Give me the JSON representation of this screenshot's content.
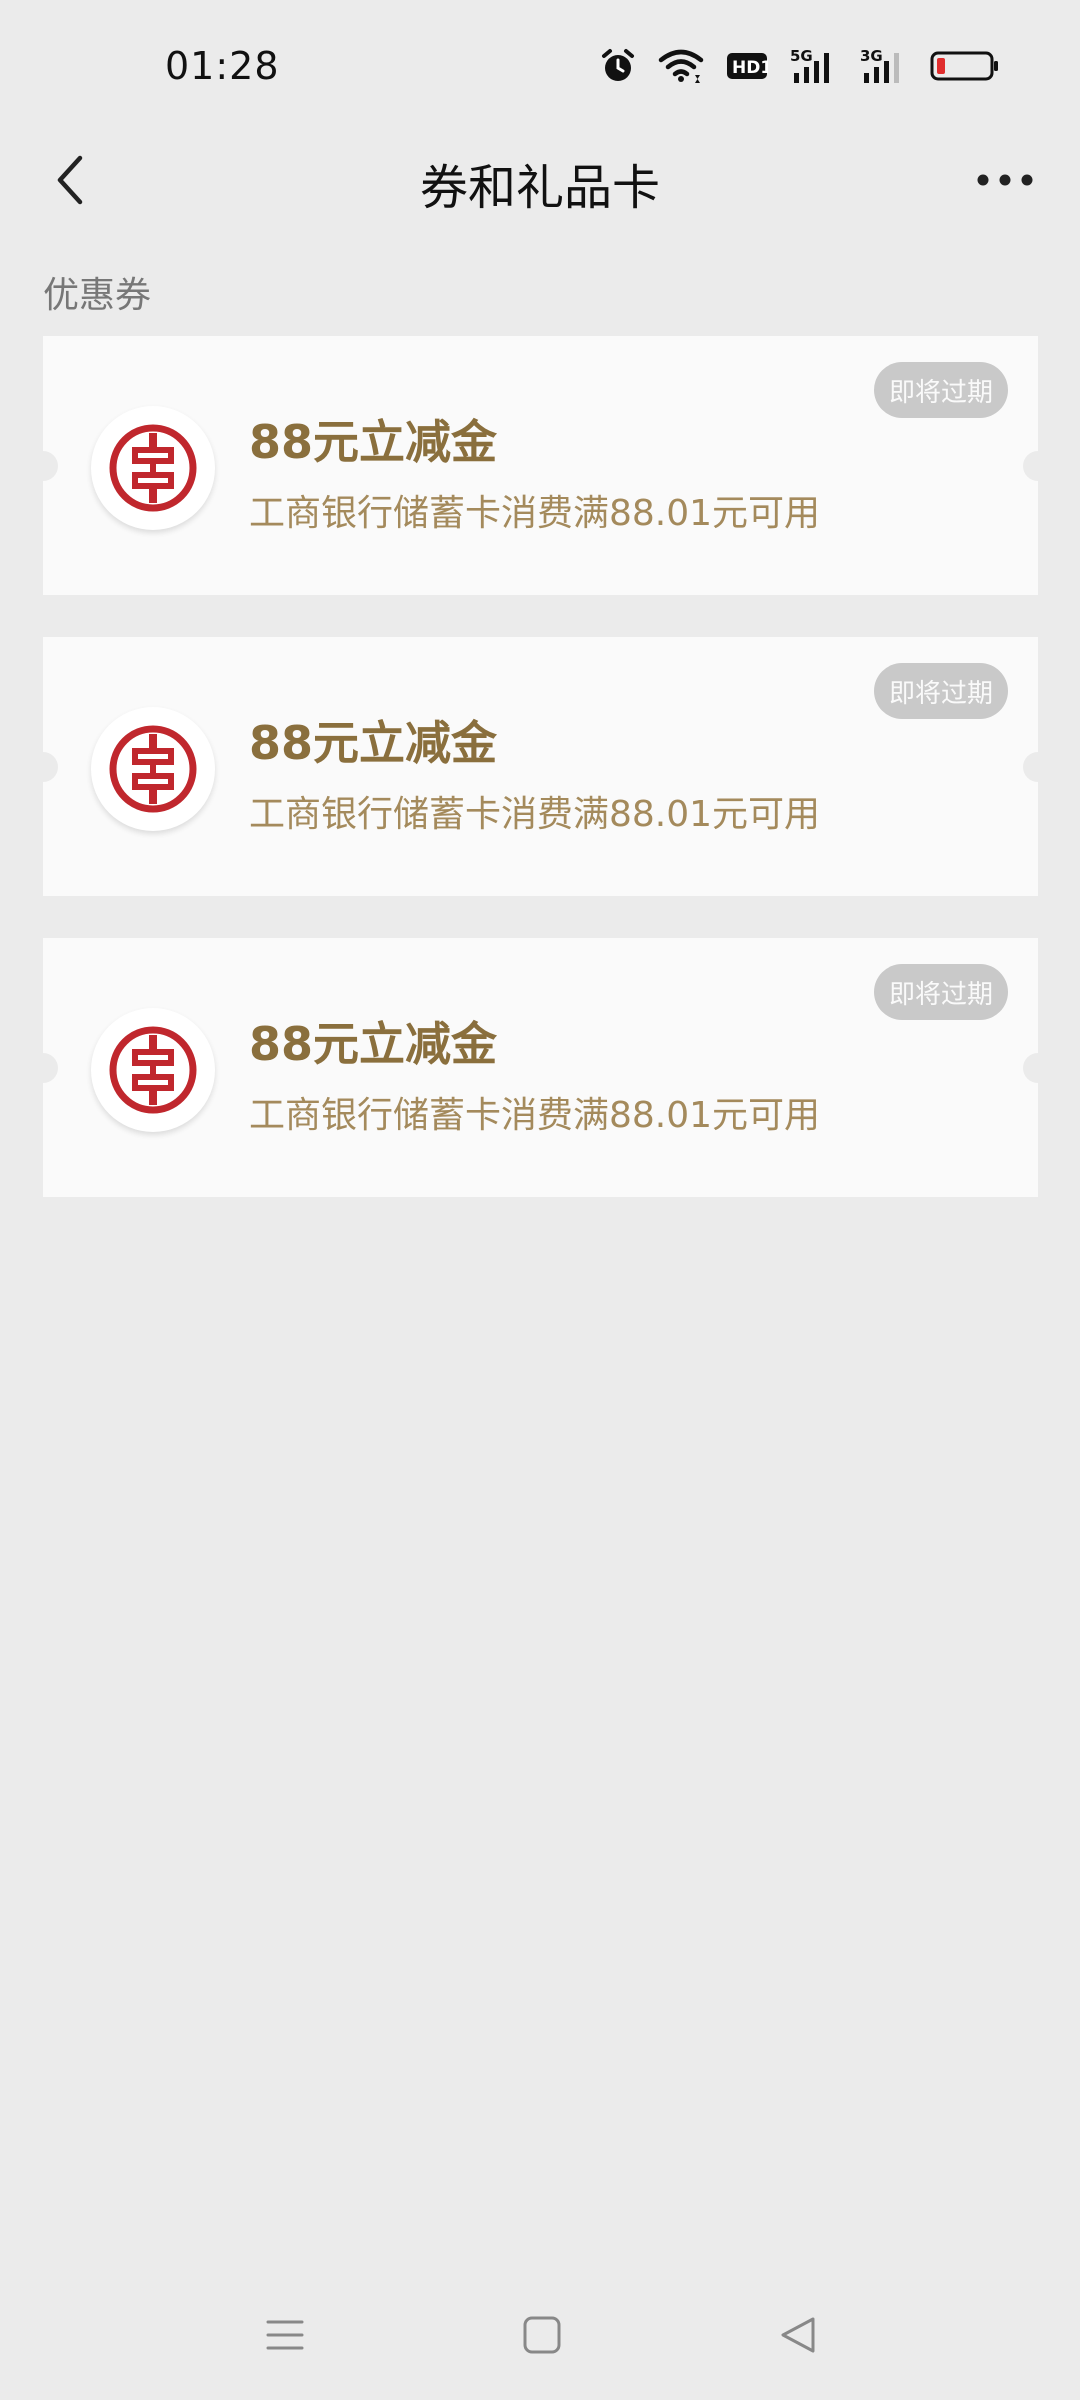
{
  "status_bar": {
    "time": "01:28",
    "icons": [
      "alarm-icon",
      "wifi-icon",
      "hd-icon",
      "signal-5g-icon",
      "signal-3g-icon",
      "battery-icon"
    ],
    "signal_labels": [
      "HD1",
      "5G",
      "3G"
    ],
    "battery_level": 0.15,
    "battery_color": "#e02d2d"
  },
  "header": {
    "title": "券和礼品卡"
  },
  "section": {
    "label": "优惠券"
  },
  "coupons": [
    {
      "amount": "88元立减金",
      "condition": "工商银行储蓄卡消费满88.01元可用",
      "badge": "即将过期"
    },
    {
      "amount": "88元立减金",
      "condition": "工商银行储蓄卡消费满88.01元可用",
      "badge": "即将过期"
    },
    {
      "amount": "88元立减金",
      "condition": "工商银行储蓄卡消费满88.01元可用",
      "badge": "即将过期"
    }
  ],
  "colors": {
    "background": "#ebebeb",
    "card": "#fafafa",
    "amount_text": "#8a6f3d",
    "condition_text": "#a48a5c",
    "badge": "#c9c9c9",
    "bank_logo": "#c0272d"
  }
}
